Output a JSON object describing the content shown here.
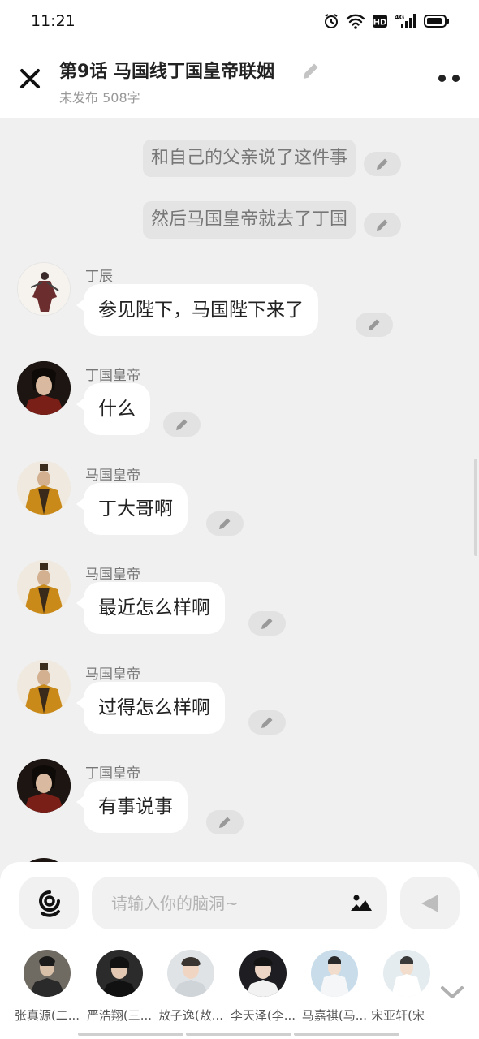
{
  "status_bar": {
    "time": "11:21",
    "network": "4G",
    "hd": "HD"
  },
  "header": {
    "title": "第9话   马国线丁国皇帝联姻",
    "meta": "未发布 508字"
  },
  "messages": [
    {
      "type": "narration",
      "text": "和自己的父亲说了这件事"
    },
    {
      "type": "narration",
      "text": "然后马国皇帝就去了丁国"
    },
    {
      "type": "dialogue",
      "speaker": "丁辰",
      "text": "参见陛下，马国陛下来了"
    },
    {
      "type": "dialogue",
      "speaker": "丁国皇帝",
      "text": "什么"
    },
    {
      "type": "dialogue",
      "speaker": "马国皇帝",
      "text": "丁大哥啊"
    },
    {
      "type": "dialogue",
      "speaker": "马国皇帝",
      "text": "最近怎么样啊"
    },
    {
      "type": "dialogue",
      "speaker": "马国皇帝",
      "text": "过得怎么样啊"
    },
    {
      "type": "dialogue",
      "speaker": "丁国皇帝",
      "text": "有事说事"
    }
  ],
  "input": {
    "placeholder": "请输入你的脑洞~"
  },
  "characters": [
    {
      "name": "张真源(二..."
    },
    {
      "name": "严浩翔(三..."
    },
    {
      "name": "敖子逸(敖..."
    },
    {
      "name": "李天泽(李..."
    },
    {
      "name": "马嘉祺(马..."
    },
    {
      "name": "宋亚轩(宋"
    }
  ],
  "colors": {
    "background": "#f0f0f0",
    "bubble": "#ffffff",
    "narration": "#e4e4e4",
    "muted_text": "#999999"
  },
  "icons": [
    "close-icon",
    "pencil-icon",
    "more-icon",
    "voice-icon",
    "image-icon",
    "send-icon",
    "chevron-down-icon"
  ]
}
